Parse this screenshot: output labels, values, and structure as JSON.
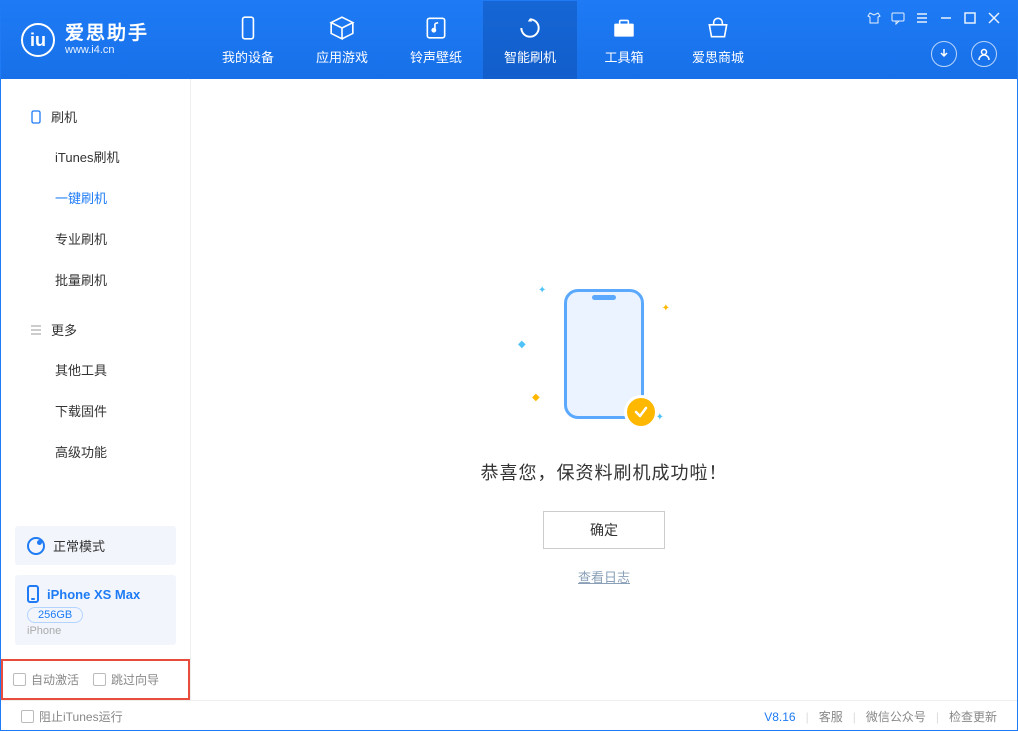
{
  "logo": {
    "title": "爱思助手",
    "sub": "www.i4.cn"
  },
  "tabs": [
    {
      "label": "我的设备"
    },
    {
      "label": "应用游戏"
    },
    {
      "label": "铃声壁纸"
    },
    {
      "label": "智能刷机"
    },
    {
      "label": "工具箱"
    },
    {
      "label": "爱思商城"
    }
  ],
  "sidebar": {
    "section1_title": "刷机",
    "items1": [
      {
        "label": "iTunes刷机"
      },
      {
        "label": "一键刷机"
      },
      {
        "label": "专业刷机"
      },
      {
        "label": "批量刷机"
      }
    ],
    "section2_title": "更多",
    "items2": [
      {
        "label": "其他工具"
      },
      {
        "label": "下载固件"
      },
      {
        "label": "高级功能"
      }
    ],
    "mode_label": "正常模式",
    "device": {
      "name": "iPhone XS Max",
      "capacity": "256GB",
      "type": "iPhone"
    },
    "checks": {
      "auto_activate": "自动激活",
      "skip_guide": "跳过向导"
    }
  },
  "main": {
    "success_text": "恭喜您，保资料刷机成功啦！",
    "ok_button": "确定",
    "log_link": "查看日志"
  },
  "footer": {
    "block_itunes": "阻止iTunes运行",
    "version": "V8.16",
    "links": {
      "support": "客服",
      "wechat": "微信公众号",
      "update": "检查更新"
    }
  }
}
